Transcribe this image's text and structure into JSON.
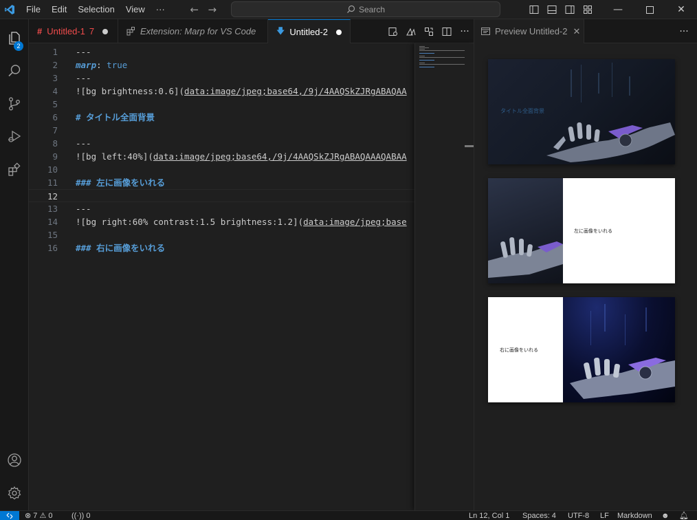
{
  "menu": {
    "items": [
      "File",
      "Edit",
      "Selection",
      "View"
    ],
    "more": "···"
  },
  "search": {
    "label": "Search"
  },
  "activity_bar": {
    "explorer_badge": "2"
  },
  "tabs": [
    {
      "label": "Untitled-1",
      "count": "7",
      "color": "#f14c4c",
      "italic": false
    },
    {
      "label": "Extension: Marp for VS Code",
      "italic": true
    },
    {
      "label": "Untitled-2",
      "active": true
    }
  ],
  "editor": {
    "current_line": 12,
    "lines": [
      {
        "num": "1",
        "text": "---"
      },
      {
        "num": "2",
        "key": "marp",
        "sep": ": ",
        "value": "true"
      },
      {
        "num": "3",
        "text": "---"
      },
      {
        "num": "4",
        "prefix": "![bg brightness:0.6](",
        "link": "data:image/jpeg;base64,/9j/4AAQSkZJRgABAQAA"
      },
      {
        "num": "5",
        "text": ""
      },
      {
        "num": "6",
        "heading": "# タイトル全面背景"
      },
      {
        "num": "7",
        "text": ""
      },
      {
        "num": "8",
        "text": "---"
      },
      {
        "num": "9",
        "prefix": "![bg left:40%](",
        "link": "data:image/jpeg;base64,/9j/4AAQSkZJRgABAQAAAQABAA"
      },
      {
        "num": "10",
        "text": ""
      },
      {
        "num": "11",
        "heading": "### 左に画像をいれる"
      },
      {
        "num": "12",
        "text": ""
      },
      {
        "num": "13",
        "text": "---"
      },
      {
        "num": "14",
        "prefix": "![bg right:60% contrast:1.5 brightness:1.2](",
        "link": "data:image/jpeg;base"
      },
      {
        "num": "15",
        "text": ""
      },
      {
        "num": "16",
        "heading": "### 右に画像をいれる"
      }
    ]
  },
  "preview": {
    "tab_label": "Preview Untitled-2",
    "slides": [
      {
        "text": "タイトル全面背景"
      },
      {
        "text": "左に画像をいれる"
      },
      {
        "text": "右に画像をいれる"
      }
    ]
  },
  "status": {
    "errors": "7",
    "warnings": "0",
    "ports": "0",
    "position": "Ln 12, Col 1",
    "spaces": "Spaces: 4",
    "encoding": "UTF-8",
    "eol": "LF",
    "language": "Markdown"
  },
  "colors": {
    "accent": "#0078d4",
    "error": "#f14c4c",
    "heading": "#569cd6",
    "background": "#1f1f1f"
  }
}
